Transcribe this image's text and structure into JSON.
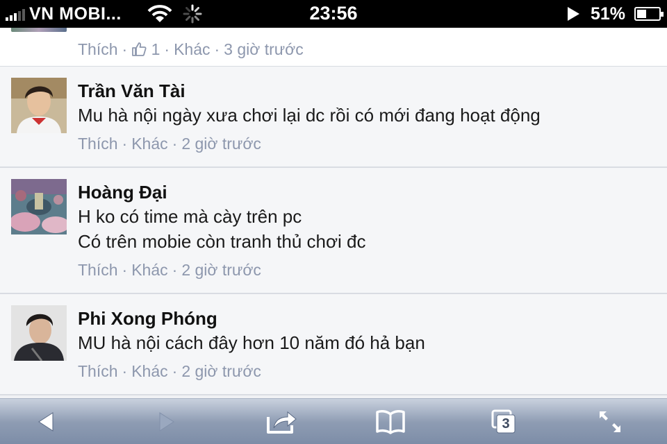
{
  "status_bar": {
    "carrier": "VN MOBI...",
    "time": "23:56",
    "battery_percent": "51%",
    "battery_level": 0.51,
    "icons": [
      "signal-icon",
      "wifi-icon",
      "activity-spinner-icon",
      "play-icon",
      "battery-icon"
    ]
  },
  "top_item": {
    "like_label": "Thích",
    "like_count": "1",
    "more_label": "Khác",
    "time_ago": "3 giờ trước"
  },
  "comments": [
    {
      "author": "Trần Văn Tài",
      "lines": [
        "Mu hà nội ngày xưa chơi lại dc rồi có mới đang hoạt động"
      ],
      "like_label": "Thích",
      "more_label": "Khác",
      "time_ago": "2 giờ trước"
    },
    {
      "author": "Hoàng Đại",
      "lines": [
        "H ko có time mà cày trên pc",
        "Có trên mobie còn tranh thủ chơi đc"
      ],
      "like_label": "Thích",
      "more_label": "Khác",
      "time_ago": "2 giờ trước"
    },
    {
      "author": "Phi Xong Phóng",
      "lines": [
        "MU hà nội cách đây hơn 10 năm đó hả bạn"
      ],
      "like_label": "Thích",
      "more_label": "Khác",
      "time_ago": "2 giờ trước"
    }
  ],
  "toolbar": {
    "tabs_count": "3",
    "icons": [
      "back-icon",
      "forward-icon",
      "share-icon",
      "bookmarks-icon",
      "tabs-icon",
      "fullscreen-icon"
    ]
  }
}
